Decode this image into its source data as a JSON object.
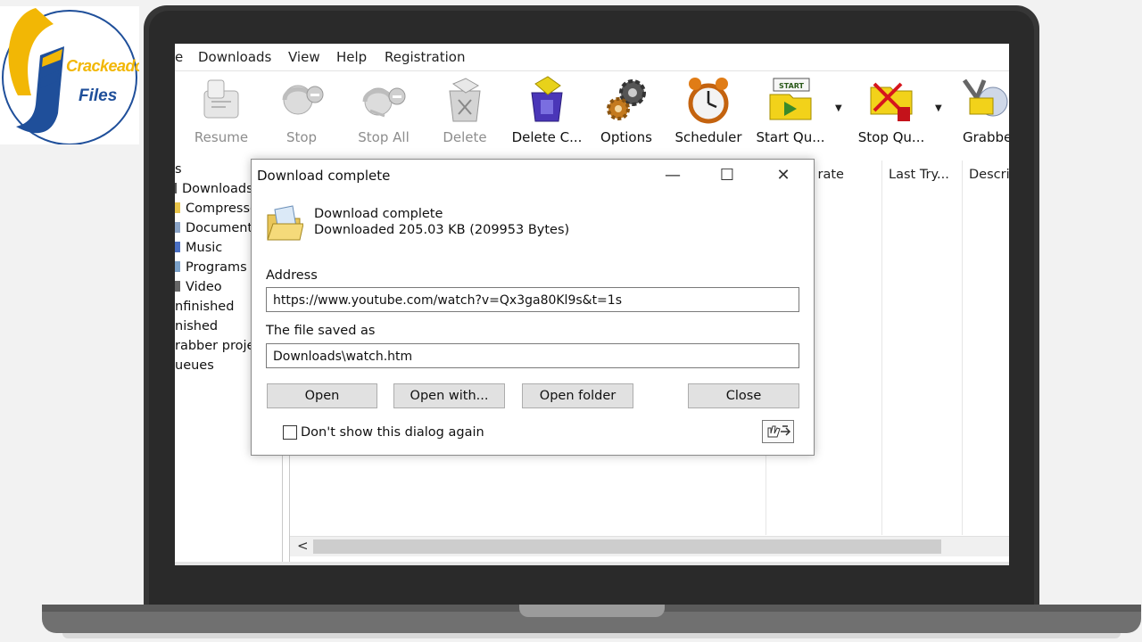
{
  "logo": {
    "line1": "Crackeado",
    "line2": "Files"
  },
  "menu": [
    "e",
    "Downloads",
    "View",
    "Help",
    "Registration"
  ],
  "toolbar": {
    "resume": "Resume",
    "stop": "Stop",
    "stop_all": "Stop All",
    "delete": "Delete",
    "delete_completed": "Delete C...",
    "options": "Options",
    "scheduler": "Scheduler",
    "start_queue": "Start Qu...",
    "stop_queue": "Stop Qu...",
    "grabber": "Grabbe",
    "start_badge": "START"
  },
  "sidebar": {
    "items": [
      "s",
      "Downloads",
      "Compresse",
      "Documents",
      "Music",
      "Programs",
      "Video",
      "nfinished",
      "nished",
      "rabber projec",
      "ueues"
    ]
  },
  "list": {
    "columns": [
      "er rate",
      "Last Try...",
      "Descrip"
    ]
  },
  "dialog": {
    "title": "Download complete",
    "message_line1": "Download complete",
    "message_line2": "Downloaded 205.03  KB (209953 Bytes)",
    "address_label": "Address",
    "address_value": "https://www.youtube.com/watch?v=Qx3ga80Kl9s&t=1s",
    "saved_as_label": "The file saved as",
    "saved_as_value": "Downloads\\watch.htm",
    "buttons": {
      "open": "Open",
      "open_with": "Open with...",
      "open_folder": "Open folder",
      "close": "Close"
    },
    "checkbox_label": "Don't show this dialog again",
    "minimize": "—",
    "maximize": "☐",
    "close_x": "✕"
  },
  "hscroll": {
    "left_arrow": "<"
  },
  "colors": {
    "logo_yellow": "#f2b705",
    "logo_blue": "#1f4f9a",
    "laptop_frame": "#363636",
    "dialog_button": "#e1e1e1"
  }
}
